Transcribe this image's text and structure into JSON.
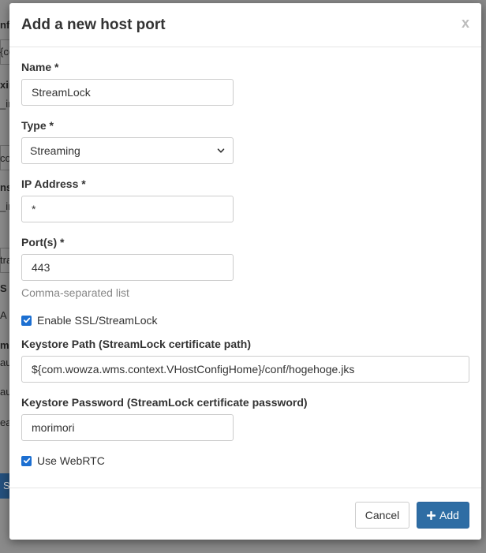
{
  "modal": {
    "title": "Add a new host port",
    "close_label": "x"
  },
  "form": {
    "name": {
      "label": "Name *",
      "value": "StreamLock"
    },
    "type": {
      "label": "Type *",
      "value": "Streaming"
    },
    "ip": {
      "label": "IP Address *",
      "value": "*"
    },
    "ports": {
      "label": "Port(s) *",
      "value": "443",
      "help": "Comma-separated list"
    },
    "ssl": {
      "label": "Enable SSL/StreamLock",
      "checked": true
    },
    "keystore_path": {
      "label": "Keystore Path (StreamLock certificate path)",
      "value": "${com.wowza.wms.context.VHostConfigHome}/conf/hogehoge.jks"
    },
    "keystore_password": {
      "label": "Keystore Password (StreamLock certificate password)",
      "value": "morimori"
    },
    "webrtc": {
      "label": "Use WebRTC",
      "checked": true
    }
  },
  "footer": {
    "cancel_label": "Cancel",
    "add_label": "Add"
  },
  "background": {
    "fragments": [
      "nfi",
      "{co",
      "xin",
      "_in",
      "co",
      "ns",
      "_in",
      "tra",
      "S",
      "A",
      "me",
      "au",
      "au",
      "ea",
      "S"
    ]
  },
  "colors": {
    "primary": "#2e6da4",
    "checkbox": "#1c6fd1",
    "overlay": "#7d7d7d"
  }
}
